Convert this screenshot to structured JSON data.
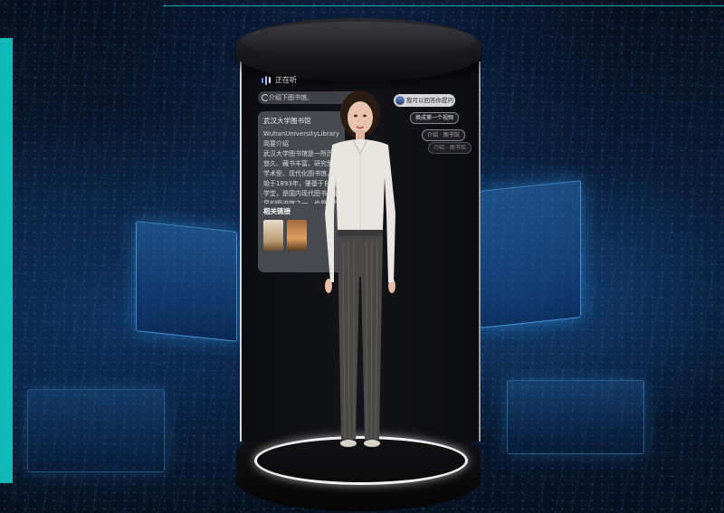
{
  "capsule": {
    "status_text": "正在听",
    "prompt_pill": "介绍下图书馆。",
    "reply_pill": "我可以回答你提问",
    "suggestions": [
      "换成第一个视频",
      "介绍 · 图书馆",
      "介绍 · 图书馆"
    ]
  },
  "info_card": {
    "title": "武汉大学图书馆",
    "subtitle_en": "WuhanUniversityLibrary",
    "subtitle_cn": "简要介绍",
    "body": "武汉大学图书馆是一所历史悠久、藏书丰富、研究型、学术型、现代化图书馆，其始于1893年，肇基于自强学堂，是国内现代图书馆最早的图书馆之一，也是国际图联的会员馆……",
    "more": "相关链接"
  },
  "colors": {
    "accent_teal": "#12b7b7",
    "capsule_dark": "#0e0e10",
    "platform_ring": "#f2f2f2"
  },
  "icons": {
    "listening": "voice-wave-icon",
    "prompt": "refresh-icon",
    "reply": "avatar-icon"
  }
}
